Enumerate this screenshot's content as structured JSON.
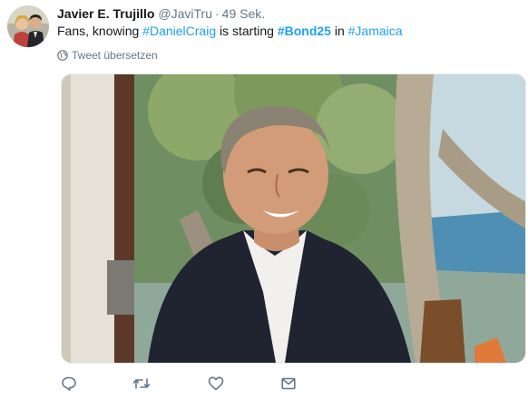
{
  "tweet": {
    "author_name": "Javier E. Trujillo",
    "handle": "@JaviTru",
    "separator": "·",
    "timestamp": "49 Sek.",
    "text_parts": {
      "p1": "Fans, knowing ",
      "h1": "#DanielCraig",
      "p2": " is starting ",
      "h2": "#Bond25",
      "p3": " in ",
      "h3": "#Jamaica"
    },
    "translate_label": "Tweet übersetzen"
  },
  "icons": {
    "globe": "globe-icon",
    "reply": "reply-icon",
    "retweet": "retweet-icon",
    "like": "heart-icon",
    "dm": "envelope-icon"
  },
  "colors": {
    "link": "#1da1f2",
    "secondary_text": "#657786",
    "primary_text": "#14171a"
  }
}
